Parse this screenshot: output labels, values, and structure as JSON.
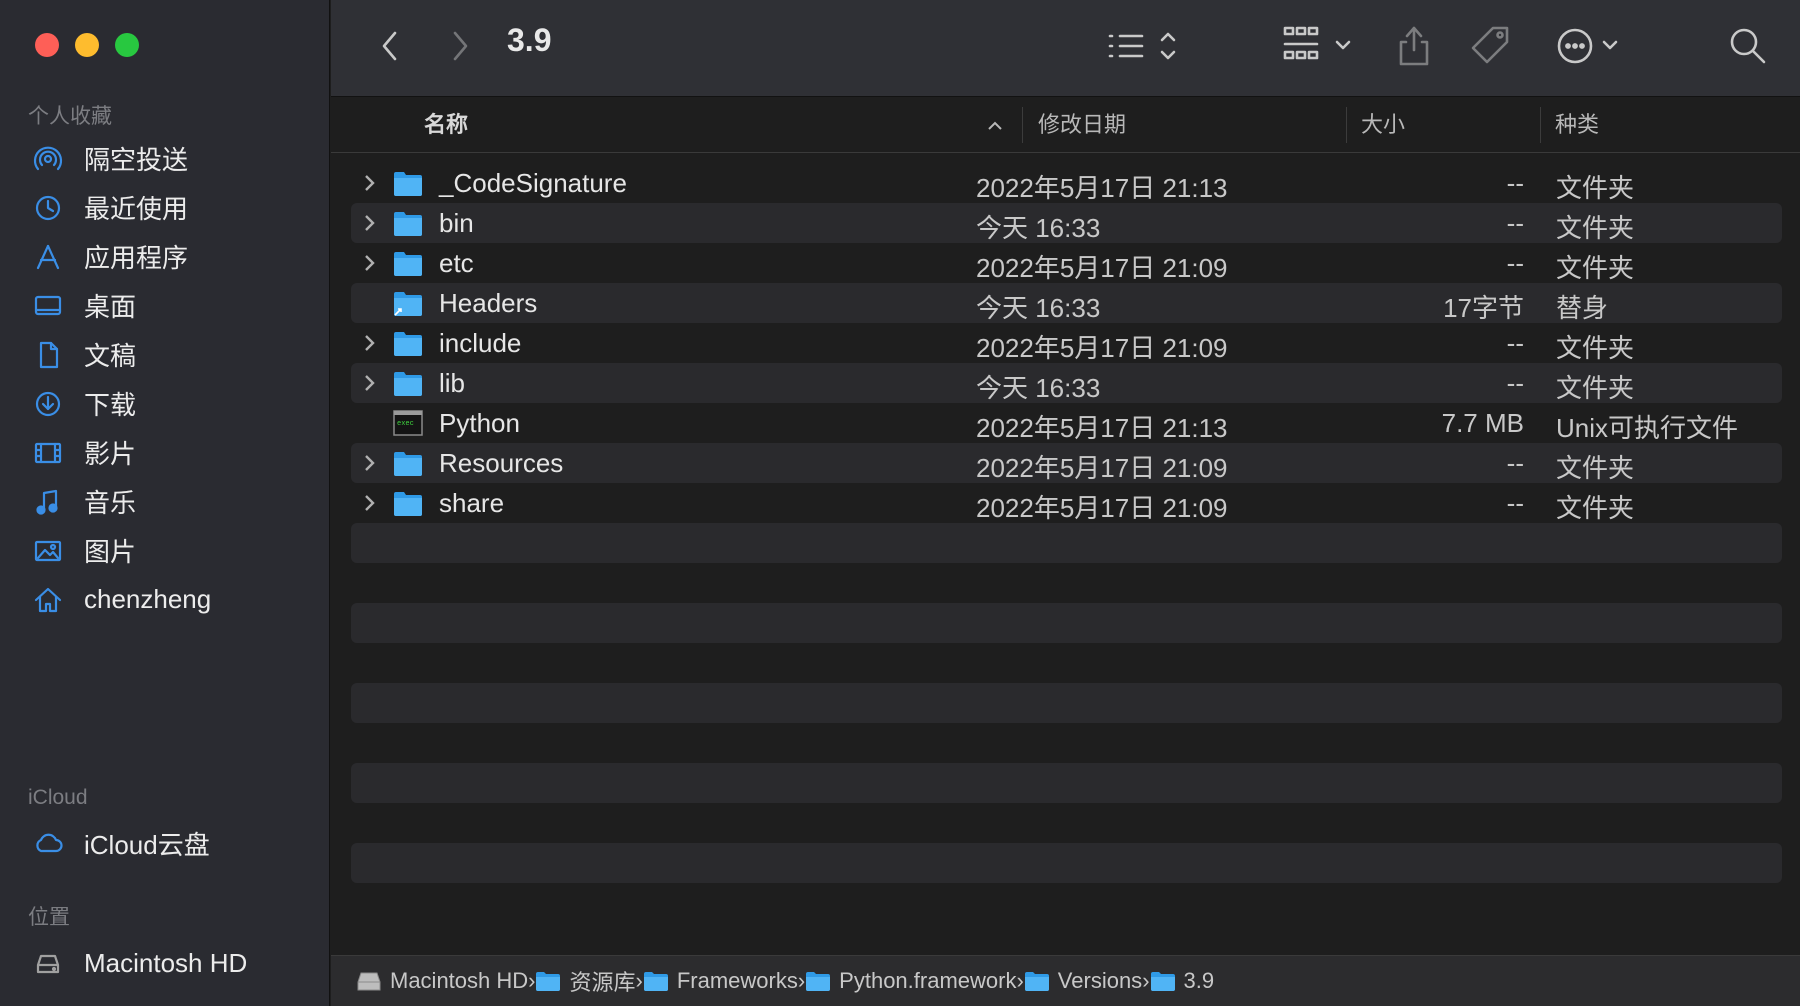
{
  "window": {
    "title": "3.9",
    "traffic_colors": {
      "close": "#fe5f57",
      "minimize": "#febc2e",
      "zoom": "#28c840"
    }
  },
  "sidebar": {
    "favorites_header": "个人收藏",
    "favorites": [
      {
        "label": "隔空投送",
        "icon": "airdrop-icon"
      },
      {
        "label": "最近使用",
        "icon": "clock-icon"
      },
      {
        "label": "应用程序",
        "icon": "applications-icon"
      },
      {
        "label": "桌面",
        "icon": "desktop-icon"
      },
      {
        "label": "文稿",
        "icon": "document-icon"
      },
      {
        "label": "下载",
        "icon": "download-icon"
      },
      {
        "label": "影片",
        "icon": "film-icon"
      },
      {
        "label": "音乐",
        "icon": "music-icon"
      },
      {
        "label": "图片",
        "icon": "photo-icon"
      },
      {
        "label": "chenzheng",
        "icon": "home-icon"
      }
    ],
    "icloud_header": "iCloud",
    "icloud": [
      {
        "label": "iCloud云盘",
        "icon": "cloud-icon"
      }
    ],
    "locations_header": "位置",
    "locations": [
      {
        "label": "Macintosh HD",
        "icon": "disk-icon"
      }
    ],
    "accent_color": "#3a8ee6"
  },
  "columns": {
    "name": "名称",
    "modified": "修改日期",
    "size": "大小",
    "kind": "种类"
  },
  "files": [
    {
      "name": "_CodeSignature",
      "date": "2022年5月17日 21:13",
      "size": "--",
      "kind": "文件夹",
      "type": "folder",
      "expandable": true
    },
    {
      "name": "bin",
      "date": "今天 16:33",
      "size": "--",
      "kind": "文件夹",
      "type": "folder",
      "expandable": true
    },
    {
      "name": "etc",
      "date": "2022年5月17日 21:09",
      "size": "--",
      "kind": "文件夹",
      "type": "folder",
      "expandable": true
    },
    {
      "name": "Headers",
      "date": "今天 16:33",
      "size": "17字节",
      "kind": "替身",
      "type": "alias",
      "expandable": false
    },
    {
      "name": "include",
      "date": "2022年5月17日 21:09",
      "size": "--",
      "kind": "文件夹",
      "type": "folder",
      "expandable": true
    },
    {
      "name": "lib",
      "date": "今天 16:33",
      "size": "--",
      "kind": "文件夹",
      "type": "folder",
      "expandable": true
    },
    {
      "name": "Python",
      "date": "2022年5月17日 21:13",
      "size": "7.7 MB",
      "kind": "Unix可执行文件",
      "type": "executable",
      "expandable": false
    },
    {
      "name": "Resources",
      "date": "2022年5月17日 21:09",
      "size": "--",
      "kind": "文件夹",
      "type": "folder",
      "expandable": true
    },
    {
      "name": "share",
      "date": "2022年5月17日 21:09",
      "size": "--",
      "kind": "文件夹",
      "type": "folder",
      "expandable": true
    }
  ],
  "pathbar": [
    {
      "label": "Macintosh HD",
      "icon": "disk-icon"
    },
    {
      "label": "资源库",
      "icon": "folder-icon"
    },
    {
      "label": "Frameworks",
      "icon": "folder-icon"
    },
    {
      "label": "Python.framework",
      "icon": "folder-icon"
    },
    {
      "label": "Versions",
      "icon": "folder-icon"
    },
    {
      "label": "3.9",
      "icon": "folder-icon"
    }
  ]
}
